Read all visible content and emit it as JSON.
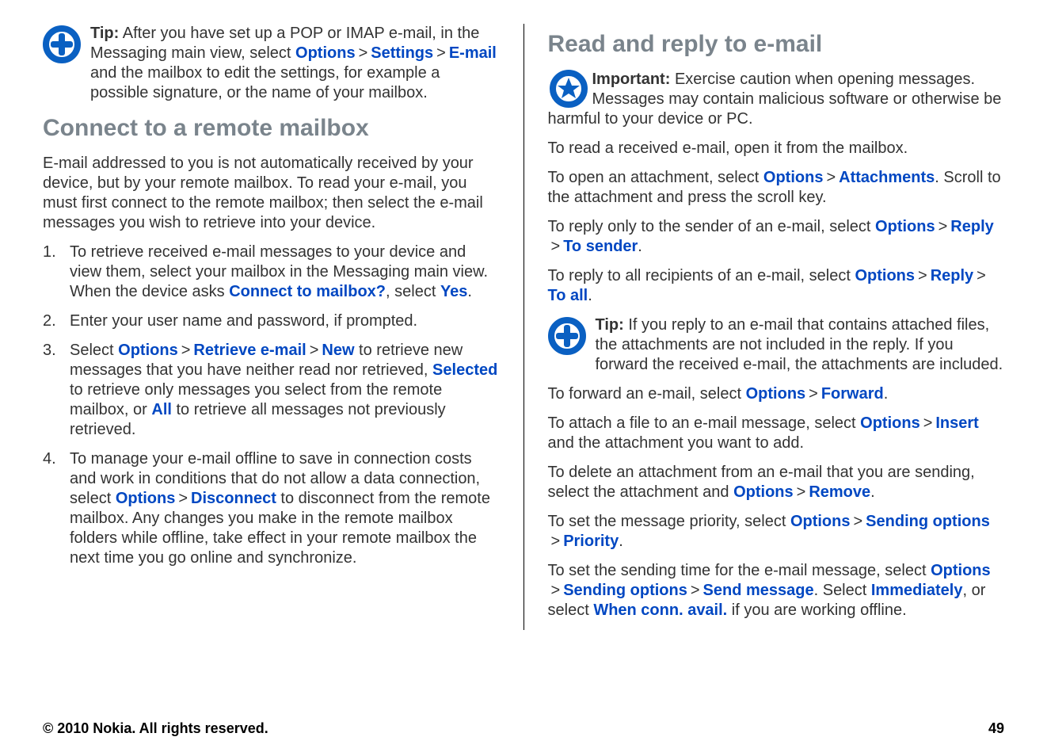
{
  "left": {
    "tip": {
      "label": "Tip:",
      "pre": " After you have set up a POP or IMAP e-mail, in the Messaging main view, select ",
      "w1": "Options",
      "w2": "Settings",
      "w3": "E-mail",
      "post": " and the mailbox to edit the settings, for example a possible signature, or the name of your mailbox."
    },
    "h2": "Connect to a remote mailbox",
    "intro": "E-mail addressed to you is not automatically received by your device, but by your remote mailbox. To read your e-mail, you must first connect to the remote mailbox; then select the e-mail messages you wish to retrieve into your device.",
    "li1": {
      "pre": "To retrieve received e-mail messages to your device and view them, select your mailbox in the Messaging main view. When the device asks ",
      "w1": "Connect to mailbox?",
      "mid": ", select ",
      "w2": "Yes",
      "post": "."
    },
    "li2": "Enter your user name and password, if prompted.",
    "li3": {
      "pre": "Select ",
      "w1": "Options",
      "w2": "Retrieve e-mail",
      "w3": "New",
      "mid1": " to retrieve new messages that you have neither read nor retrieved, ",
      "w4": "Selected",
      "mid2": " to retrieve only messages you select from the remote mailbox, or ",
      "w5": "All",
      "post": " to retrieve all messages not previously retrieved."
    },
    "li4": {
      "pre": "To manage your e-mail offline to save in connection costs and work in conditions that do not allow a data connection, select ",
      "w1": "Options",
      "w2": "Disconnect",
      "post": " to disconnect from the remote mailbox. Any changes you make in the remote mailbox folders while offline, take effect in your remote mailbox the next time you go online and synchronize."
    }
  },
  "right": {
    "h2": "Read and reply to e-mail",
    "important": {
      "label": "Important:",
      "text": "  Exercise caution when opening messages. Messages may contain malicious software or otherwise be harmful to your device or PC."
    },
    "p_read": "To read a received e-mail, open it from the mailbox.",
    "p_attach_open": {
      "pre": "To open an attachment, select ",
      "w1": "Options",
      "w2": "Attachments",
      "post": ". Scroll to the attachment and press the scroll key."
    },
    "p_reply_sender": {
      "pre": "To reply only to the sender of an e-mail, select ",
      "w1": "Options",
      "w2": "Reply",
      "w3": "To sender",
      "post": "."
    },
    "p_reply_all": {
      "pre": "To reply to all recipients of an e-mail, select ",
      "w1": "Options",
      "w2": "Reply",
      "w3": "To all",
      "post": "."
    },
    "tip": {
      "label": "Tip:",
      "text": " If you reply to an e-mail that contains attached files, the attachments are not included in the reply. If you forward the received e-mail, the attachments are included."
    },
    "p_forward": {
      "pre": "To forward an e-mail, select ",
      "w1": "Options",
      "w2": "Forward",
      "post": "."
    },
    "p_attach_file": {
      "pre": "To attach a file to an e-mail message, select ",
      "w1": "Options",
      "w2": "Insert",
      "post": " and the attachment you want to add."
    },
    "p_delete_attach": {
      "pre": "To delete an attachment from an e-mail that you are sending, select the attachment and ",
      "w1": "Options",
      "w2": "Remove",
      "post": "."
    },
    "p_priority": {
      "pre": "To set the message priority, select ",
      "w1": "Options",
      "w2": "Sending options",
      "w3": "Priority",
      "post": "."
    },
    "p_sendtime": {
      "pre": "To set the sending time for the e-mail message, select ",
      "w1": "Options",
      "w2": "Sending options",
      "w3": "Send message",
      "mid1": ". Select ",
      "w4": "Immediately",
      "mid2": ", or select ",
      "w5": "When conn. avail.",
      "post": " if you are working offline."
    }
  },
  "gt": ">",
  "footer": {
    "copyright": "© 2010 Nokia. All rights reserved.",
    "page": "49"
  }
}
